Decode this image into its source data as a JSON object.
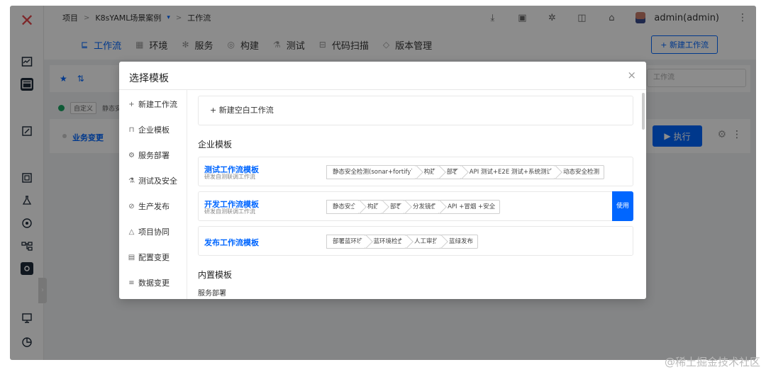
{
  "header": {
    "breadcrumb": {
      "project": "项目",
      "sep": ">",
      "project_name": "K8sYAML场景案例",
      "caret": "▾",
      "page": "工作流"
    },
    "user": "admin(admin)"
  },
  "nav": {
    "tabs": [
      {
        "label": "工作流",
        "icon": "workflow-icon"
      },
      {
        "label": "环境",
        "icon": "environment-icon"
      },
      {
        "label": "服务",
        "icon": "service-icon"
      },
      {
        "label": "构建",
        "icon": "build-icon"
      },
      {
        "label": "测试",
        "icon": "test-icon"
      },
      {
        "label": "代码扫描",
        "icon": "scan-icon"
      },
      {
        "label": "版本管理",
        "icon": "version-icon"
      }
    ],
    "new_workflow": "+ 新建工作流"
  },
  "background": {
    "search_placeholder": "工作流",
    "tag_custom": "自定义",
    "tag_static": "静态安",
    "workflow_name": "业务变更",
    "run_button": "执行"
  },
  "modal": {
    "title": "选择模板",
    "close": "×",
    "menu": [
      {
        "label": "新建工作流",
        "icon": "plus-icon"
      },
      {
        "label": "企业模板",
        "icon": "enterprise-icon"
      },
      {
        "label": "服务部署",
        "icon": "deploy-icon"
      },
      {
        "label": "测试及安全",
        "icon": "flask-icon"
      },
      {
        "label": "生产发布",
        "icon": "release-icon"
      },
      {
        "label": "项目协同",
        "icon": "collab-icon"
      },
      {
        "label": "配置变更",
        "icon": "config-icon"
      },
      {
        "label": "数据变更",
        "icon": "database-icon"
      }
    ],
    "blank_workflow": "+ 新建空白工作流",
    "enterprise_section": "企业模板",
    "templates": [
      {
        "name": "测试工作流模板",
        "desc": "研发自测联调工作流",
        "steps": [
          "静态安全检测(sonar+fortify)",
          "构建",
          "部署",
          "API 测试+E2E 测试+系统测试",
          "动态安全检测"
        ]
      },
      {
        "name": "开发工作流模板",
        "desc": "研发自测联调工作流",
        "steps": [
          "静态安全",
          "构建",
          "部署",
          "分发镜像",
          "API +冒烟 +安全"
        ],
        "use_label": "使用"
      },
      {
        "name": "发布工作流模板",
        "desc": "",
        "steps": [
          "部署蓝环境",
          "蓝环境检查",
          "人工审批",
          "蓝绿发布"
        ]
      }
    ],
    "builtin_section": "内置模板",
    "builtin_sub": "服务部署"
  },
  "watermark": "@稀土掘金技术社区",
  "colors": {
    "primary": "#0066ff",
    "logo": "#e5484d",
    "success": "#1aa463"
  }
}
